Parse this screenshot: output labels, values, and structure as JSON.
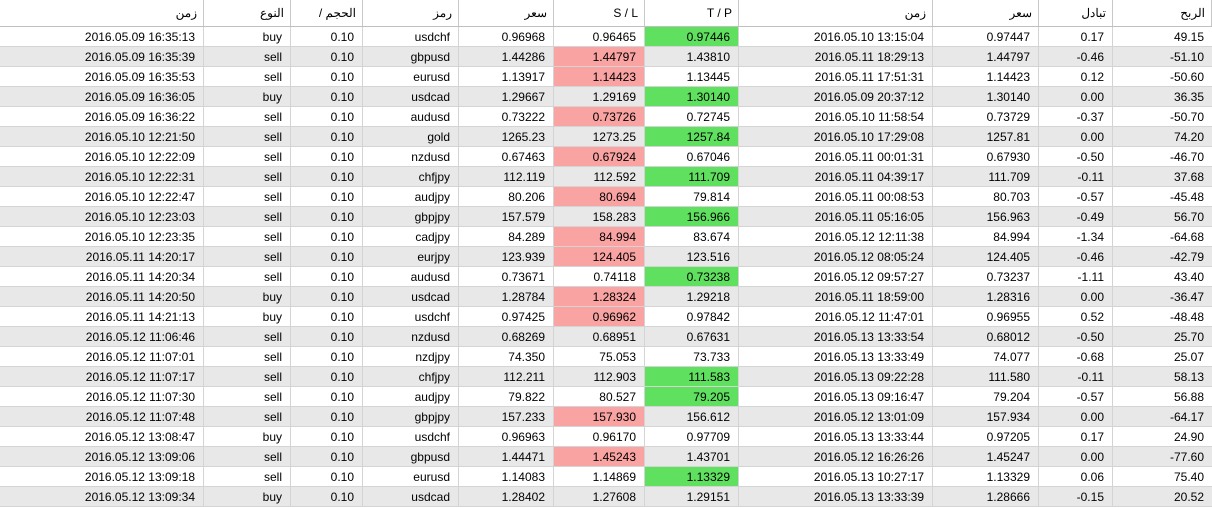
{
  "colors": {
    "stop_loss_hit": "#f9a3a3",
    "take_profit_hit": "#5fe05f",
    "alt_row": "#e8e8e8"
  },
  "columns": [
    "زمن",
    "النوع",
    "/ الحجم",
    "رمز",
    "سعر",
    "S / L",
    "T / P",
    "زمن",
    "سعر",
    "تبادل",
    "الربح"
  ],
  "rows": [
    {
      "open_time": "2016.05.09 16:35:13",
      "type": "buy",
      "volume": "0.10",
      "symbol": "usdchf",
      "open_price": "0.96968",
      "sl": "0.96465",
      "tp": "0.97446",
      "close_time": "2016.05.10 13:15:04",
      "close_price": "0.97447",
      "swap": "0.17",
      "profit": "49.15",
      "hit": "tp"
    },
    {
      "open_time": "2016.05.09 16:35:39",
      "type": "sell",
      "volume": "0.10",
      "symbol": "gbpusd",
      "open_price": "1.44286",
      "sl": "1.44797",
      "tp": "1.43810",
      "close_time": "2016.05.11 18:29:13",
      "close_price": "1.44797",
      "swap": "-0.46",
      "profit": "-51.10",
      "hit": "sl"
    },
    {
      "open_time": "2016.05.09 16:35:53",
      "type": "sell",
      "volume": "0.10",
      "symbol": "eurusd",
      "open_price": "1.13917",
      "sl": "1.14423",
      "tp": "1.13445",
      "close_time": "2016.05.11 17:51:31",
      "close_price": "1.14423",
      "swap": "0.12",
      "profit": "-50.60",
      "hit": "sl"
    },
    {
      "open_time": "2016.05.09 16:36:05",
      "type": "buy",
      "volume": "0.10",
      "symbol": "usdcad",
      "open_price": "1.29667",
      "sl": "1.29169",
      "tp": "1.30140",
      "close_time": "2016.05.09 20:37:12",
      "close_price": "1.30140",
      "swap": "0.00",
      "profit": "36.35",
      "hit": "tp"
    },
    {
      "open_time": "2016.05.09 16:36:22",
      "type": "sell",
      "volume": "0.10",
      "symbol": "audusd",
      "open_price": "0.73222",
      "sl": "0.73726",
      "tp": "0.72745",
      "close_time": "2016.05.10 11:58:54",
      "close_price": "0.73729",
      "swap": "-0.37",
      "profit": "-50.70",
      "hit": "sl"
    },
    {
      "open_time": "2016.05.10 12:21:50",
      "type": "sell",
      "volume": "0.10",
      "symbol": "gold",
      "open_price": "1265.23",
      "sl": "1273.25",
      "tp": "1257.84",
      "close_time": "2016.05.10 17:29:08",
      "close_price": "1257.81",
      "swap": "0.00",
      "profit": "74.20",
      "hit": "tp"
    },
    {
      "open_time": "2016.05.10 12:22:09",
      "type": "sell",
      "volume": "0.10",
      "symbol": "nzdusd",
      "open_price": "0.67463",
      "sl": "0.67924",
      "tp": "0.67046",
      "close_time": "2016.05.11 00:01:31",
      "close_price": "0.67930",
      "swap": "-0.50",
      "profit": "-46.70",
      "hit": "sl"
    },
    {
      "open_time": "2016.05.10 12:22:31",
      "type": "sell",
      "volume": "0.10",
      "symbol": "chfjpy",
      "open_price": "112.119",
      "sl": "112.592",
      "tp": "111.709",
      "close_time": "2016.05.11 04:39:17",
      "close_price": "111.709",
      "swap": "-0.11",
      "profit": "37.68",
      "hit": "tp"
    },
    {
      "open_time": "2016.05.10 12:22:47",
      "type": "sell",
      "volume": "0.10",
      "symbol": "audjpy",
      "open_price": "80.206",
      "sl": "80.694",
      "tp": "79.814",
      "close_time": "2016.05.11 00:08:53",
      "close_price": "80.703",
      "swap": "-0.57",
      "profit": "-45.48",
      "hit": "sl"
    },
    {
      "open_time": "2016.05.10 12:23:03",
      "type": "sell",
      "volume": "0.10",
      "symbol": "gbpjpy",
      "open_price": "157.579",
      "sl": "158.283",
      "tp": "156.966",
      "close_time": "2016.05.11 05:16:05",
      "close_price": "156.963",
      "swap": "-0.49",
      "profit": "56.70",
      "hit": "tp"
    },
    {
      "open_time": "2016.05.10 12:23:35",
      "type": "sell",
      "volume": "0.10",
      "symbol": "cadjpy",
      "open_price": "84.289",
      "sl": "84.994",
      "tp": "83.674",
      "close_time": "2016.05.12 12:11:38",
      "close_price": "84.994",
      "swap": "-1.34",
      "profit": "-64.68",
      "hit": "sl"
    },
    {
      "open_time": "2016.05.11 14:20:17",
      "type": "sell",
      "volume": "0.10",
      "symbol": "eurjpy",
      "open_price": "123.939",
      "sl": "124.405",
      "tp": "123.516",
      "close_time": "2016.05.12 08:05:24",
      "close_price": "124.405",
      "swap": "-0.46",
      "profit": "-42.79",
      "hit": "sl"
    },
    {
      "open_time": "2016.05.11 14:20:34",
      "type": "sell",
      "volume": "0.10",
      "symbol": "audusd",
      "open_price": "0.73671",
      "sl": "0.74118",
      "tp": "0.73238",
      "close_time": "2016.05.12 09:57:27",
      "close_price": "0.73237",
      "swap": "-1.11",
      "profit": "43.40",
      "hit": "tp"
    },
    {
      "open_time": "2016.05.11 14:20:50",
      "type": "buy",
      "volume": "0.10",
      "symbol": "usdcad",
      "open_price": "1.28784",
      "sl": "1.28324",
      "tp": "1.29218",
      "close_time": "2016.05.11 18:59:00",
      "close_price": "1.28316",
      "swap": "0.00",
      "profit": "-36.47",
      "hit": "sl"
    },
    {
      "open_time": "2016.05.11 14:21:13",
      "type": "buy",
      "volume": "0.10",
      "symbol": "usdchf",
      "open_price": "0.97425",
      "sl": "0.96962",
      "tp": "0.97842",
      "close_time": "2016.05.12 11:47:01",
      "close_price": "0.96955",
      "swap": "0.52",
      "profit": "-48.48",
      "hit": "sl"
    },
    {
      "open_time": "2016.05.12 11:06:46",
      "type": "sell",
      "volume": "0.10",
      "symbol": "nzdusd",
      "open_price": "0.68269",
      "sl": "0.68951",
      "tp": "0.67631",
      "close_time": "2016.05.13 13:33:54",
      "close_price": "0.68012",
      "swap": "-0.50",
      "profit": "25.70",
      "hit": ""
    },
    {
      "open_time": "2016.05.12 11:07:01",
      "type": "sell",
      "volume": "0.10",
      "symbol": "nzdjpy",
      "open_price": "74.350",
      "sl": "75.053",
      "tp": "73.733",
      "close_time": "2016.05.13 13:33:49",
      "close_price": "74.077",
      "swap": "-0.68",
      "profit": "25.07",
      "hit": ""
    },
    {
      "open_time": "2016.05.12 11:07:17",
      "type": "sell",
      "volume": "0.10",
      "symbol": "chfjpy",
      "open_price": "112.211",
      "sl": "112.903",
      "tp": "111.583",
      "close_time": "2016.05.13 09:22:28",
      "close_price": "111.580",
      "swap": "-0.11",
      "profit": "58.13",
      "hit": "tp"
    },
    {
      "open_time": "2016.05.12 11:07:30",
      "type": "sell",
      "volume": "0.10",
      "symbol": "audjpy",
      "open_price": "79.822",
      "sl": "80.527",
      "tp": "79.205",
      "close_time": "2016.05.13 09:16:47",
      "close_price": "79.204",
      "swap": "-0.57",
      "profit": "56.88",
      "hit": "tp"
    },
    {
      "open_time": "2016.05.12 11:07:48",
      "type": "sell",
      "volume": "0.10",
      "symbol": "gbpjpy",
      "open_price": "157.233",
      "sl": "157.930",
      "tp": "156.612",
      "close_time": "2016.05.12 13:01:09",
      "close_price": "157.934",
      "swap": "0.00",
      "profit": "-64.17",
      "hit": "sl"
    },
    {
      "open_time": "2016.05.12 13:08:47",
      "type": "buy",
      "volume": "0.10",
      "symbol": "usdchf",
      "open_price": "0.96963",
      "sl": "0.96170",
      "tp": "0.97709",
      "close_time": "2016.05.13 13:33:44",
      "close_price": "0.97205",
      "swap": "0.17",
      "profit": "24.90",
      "hit": ""
    },
    {
      "open_time": "2016.05.12 13:09:06",
      "type": "sell",
      "volume": "0.10",
      "symbol": "gbpusd",
      "open_price": "1.44471",
      "sl": "1.45243",
      "tp": "1.43701",
      "close_time": "2016.05.12 16:26:26",
      "close_price": "1.45247",
      "swap": "0.00",
      "profit": "-77.60",
      "hit": "sl"
    },
    {
      "open_time": "2016.05.12 13:09:18",
      "type": "sell",
      "volume": "0.10",
      "symbol": "eurusd",
      "open_price": "1.14083",
      "sl": "1.14869",
      "tp": "1.13329",
      "close_time": "2016.05.13 10:27:17",
      "close_price": "1.13329",
      "swap": "0.06",
      "profit": "75.40",
      "hit": "tp"
    },
    {
      "open_time": "2016.05.12 13:09:34",
      "type": "buy",
      "volume": "0.10",
      "symbol": "usdcad",
      "open_price": "1.28402",
      "sl": "1.27608",
      "tp": "1.29151",
      "close_time": "2016.05.13 13:33:39",
      "close_price": "1.28666",
      "swap": "-0.15",
      "profit": "20.52",
      "hit": ""
    }
  ]
}
